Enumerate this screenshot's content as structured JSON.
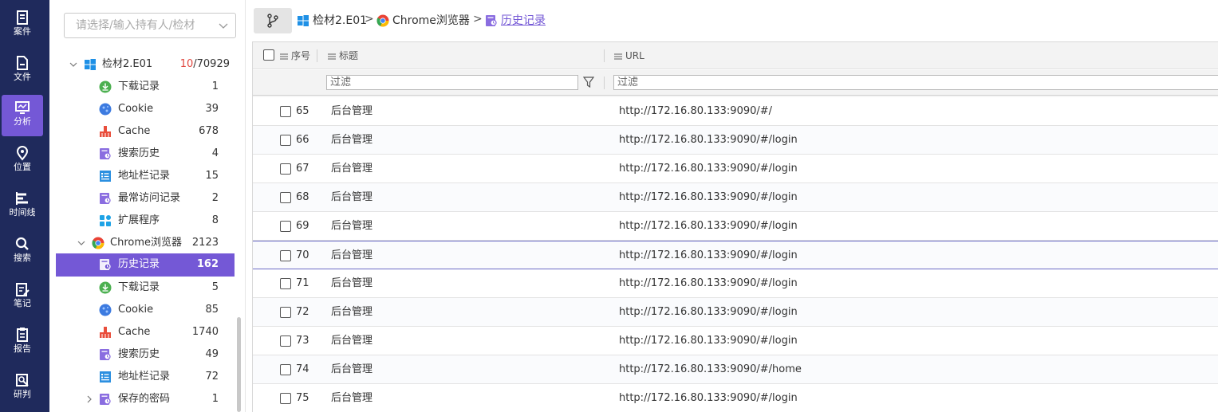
{
  "rail": [
    {
      "label": "案件",
      "icon": "case-icon",
      "active": false
    },
    {
      "label": "文件",
      "icon": "file-icon",
      "active": false
    },
    {
      "label": "分析",
      "icon": "analysis-icon",
      "active": true
    },
    {
      "label": "位置",
      "icon": "location-icon",
      "active": false
    },
    {
      "label": "时间线",
      "icon": "timeline-icon",
      "active": false
    },
    {
      "label": "搜索",
      "icon": "search-icon",
      "active": false
    },
    {
      "label": "笔记",
      "icon": "note-icon",
      "active": false
    },
    {
      "label": "报告",
      "icon": "report-icon",
      "active": false
    },
    {
      "label": "研判",
      "icon": "judge-icon",
      "active": false
    }
  ],
  "search": {
    "placeholder": "请选择/输入持有人/检材"
  },
  "tree": {
    "root": {
      "label": "检材2.E01",
      "count_highlight": "10",
      "count_rest": "/70929"
    },
    "items_a": [
      {
        "label": "下载记录",
        "count": "1",
        "icon": "download-icon"
      },
      {
        "label": "Cookie",
        "count": "39",
        "icon": "cookie-icon"
      },
      {
        "label": "Cache",
        "count": "678",
        "icon": "cache-icon"
      },
      {
        "label": "搜索历史",
        "count": "4",
        "icon": "search-history-icon"
      },
      {
        "label": "地址栏记录",
        "count": "15",
        "icon": "address-bar-icon"
      },
      {
        "label": "最常访问记录",
        "count": "2",
        "icon": "frequent-visit-icon"
      },
      {
        "label": "扩展程序",
        "count": "8",
        "icon": "extension-icon"
      }
    ],
    "chrome": {
      "label": "Chrome浏览器",
      "count": "2123"
    },
    "items_b": [
      {
        "label": "历史记录",
        "count": "162",
        "icon": "history-icon",
        "active": true
      },
      {
        "label": "下载记录",
        "count": "5",
        "icon": "download-icon"
      },
      {
        "label": "Cookie",
        "count": "85",
        "icon": "cookie-icon"
      },
      {
        "label": "Cache",
        "count": "1740",
        "icon": "cache-icon"
      },
      {
        "label": "搜索历史",
        "count": "49",
        "icon": "search-history-icon"
      },
      {
        "label": "地址栏记录",
        "count": "72",
        "icon": "address-bar-icon"
      },
      {
        "label": "保存的密码",
        "count": "1",
        "icon": "saved-password-icon"
      }
    ]
  },
  "breadcrumb": {
    "items": [
      "检材2.E01",
      "Chrome浏览器",
      "历史记录"
    ],
    "separator": ">"
  },
  "table": {
    "columns": {
      "no": "序号",
      "title": "标题",
      "url": "URL"
    },
    "filter_placeholder": "过滤",
    "rows": [
      {
        "no": "65",
        "title": "后台管理",
        "url": "http://172.16.80.133:9090/#/"
      },
      {
        "no": "66",
        "title": "后台管理",
        "url": "http://172.16.80.133:9090/#/login"
      },
      {
        "no": "67",
        "title": "后台管理",
        "url": "http://172.16.80.133:9090/#/login"
      },
      {
        "no": "68",
        "title": "后台管理",
        "url": "http://172.16.80.133:9090/#/login"
      },
      {
        "no": "69",
        "title": "后台管理",
        "url": "http://172.16.80.133:9090/#/login"
      },
      {
        "no": "70",
        "title": "后台管理",
        "url": "http://172.16.80.133:9090/#/login"
      },
      {
        "no": "71",
        "title": "后台管理",
        "url": "http://172.16.80.133:9090/#/login"
      },
      {
        "no": "72",
        "title": "后台管理",
        "url": "http://172.16.80.133:9090/#/login"
      },
      {
        "no": "73",
        "title": "后台管理",
        "url": "http://172.16.80.133:9090/#/login"
      },
      {
        "no": "74",
        "title": "后台管理",
        "url": "http://172.16.80.133:9090/#/home"
      },
      {
        "no": "75",
        "title": "后台管理",
        "url": "http://172.16.80.133:9090/#/login"
      }
    ]
  },
  "colors": {
    "accent": "#7458d6",
    "rail_bg": "#1f2a5c",
    "count_highlight": "#e0473f"
  }
}
